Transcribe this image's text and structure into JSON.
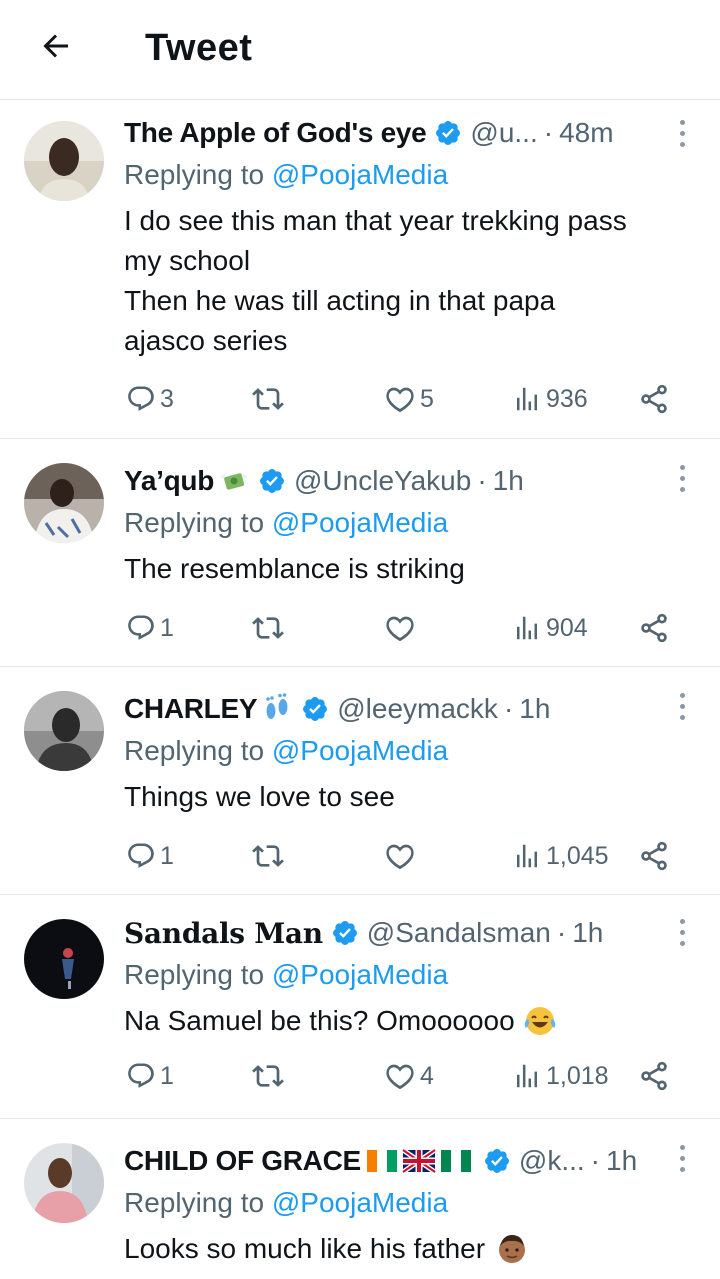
{
  "header": {
    "title": "Tweet"
  },
  "tweets": [
    {
      "name": "The Apple of God's eye",
      "handle": "@u...",
      "time": "48m",
      "replying_prefix": "Replying to",
      "replying_to": "@PoojaMedia",
      "text_lines": [
        "I do see this man that year trekking pass",
        "my school",
        "Then he was till acting in that papa",
        "ajasco series"
      ],
      "replies": "3",
      "retweets": "",
      "likes": "5",
      "views": "936"
    },
    {
      "name": "Ya’qub",
      "name_emoji": "money-with-wings-icon",
      "handle": "@UncleYakub",
      "time": "1h",
      "replying_prefix": "Replying to",
      "replying_to": "@PoojaMedia",
      "text_lines": [
        "The resemblance is striking"
      ],
      "replies": "1",
      "retweets": "",
      "likes": "",
      "views": "904"
    },
    {
      "name": "CHARLEY",
      "name_emoji": "footprints-icon",
      "handle": "@leeymackk",
      "time": "1h",
      "replying_prefix": "Replying to",
      "replying_to": "@PoojaMedia",
      "text_lines": [
        "Things we love to see"
      ],
      "replies": "1",
      "retweets": "",
      "likes": "",
      "views": "1,045"
    },
    {
      "name": "Sandals Man",
      "handle": "@Sandalsman",
      "time": "1h",
      "replying_prefix": "Replying to",
      "replying_to": "@PoojaMedia",
      "text_lines": [
        "Na Samuel be this? Omoooooo"
      ],
      "text_emoji": "tears-of-joy-icon",
      "replies": "1",
      "retweets": "",
      "likes": "4",
      "views": "1,018"
    },
    {
      "name": "CHILD OF GRACE",
      "name_emoji": "flags-ci-gb-ng-icon",
      "handle": "@k...",
      "time": "1h",
      "replying_prefix": "Replying to",
      "replying_to": "@PoojaMedia",
      "text_lines": [
        "Looks so much like his father"
      ],
      "text_emoji": "man-medium-skin-icon"
    }
  ],
  "colors": {
    "verified": "#1d9bf0",
    "mention": "#1d9bf0",
    "secondary": "#536471"
  }
}
